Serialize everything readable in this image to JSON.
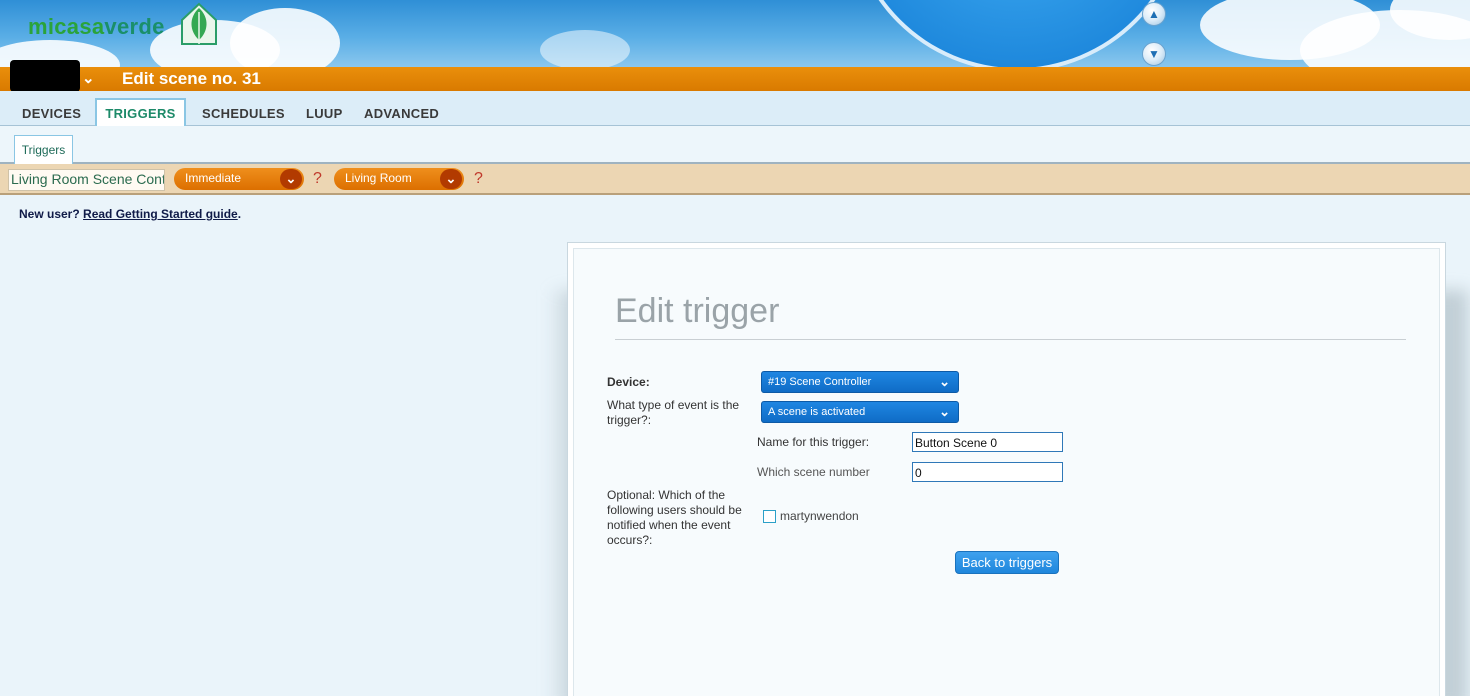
{
  "header": {
    "logo_text_part1": "micasa",
    "logo_text_part2": "verde",
    "scene_title": "Edit scene no. 31",
    "user_menu_icon": "chevron-down-icon",
    "scroll_up_icon": "eject-up-icon",
    "scroll_down_icon": "eject-down-icon"
  },
  "tabs": [
    {
      "label": "DEVICES"
    },
    {
      "label": "TRIGGERS",
      "active": true
    },
    {
      "label": "SCHEDULES"
    },
    {
      "label": "LUUP"
    },
    {
      "label": "ADVANCED"
    }
  ],
  "subtabs": [
    {
      "label": "Triggers",
      "active": true
    }
  ],
  "trigger_strip": {
    "name_value": "Living Room Scene Cont",
    "timing_value": "Immediate",
    "room_value": "Living Room",
    "help_mark": "?"
  },
  "getting_started": {
    "prefix": "New user? ",
    "link": "Read Getting Started guide",
    "suffix": "."
  },
  "dialog": {
    "title": "Edit trigger",
    "device_label": "Device:",
    "device_value": "#19 Scene Controller",
    "event_label": "What type of event is the trigger?:",
    "event_value": "A scene is activated",
    "name_label": "Name for this trigger:",
    "name_value": "Button Scene 0",
    "scene_number_label": "Which scene number",
    "scene_number_value": "0",
    "notify_label": "Optional: Which of the following users should be notified when the event occurs?:",
    "notify_user": "martynwendon",
    "back_button": "Back to triggers"
  },
  "colors": {
    "orange_bar": "#d97a00",
    "active_tab_text": "#1d8a69",
    "select_blue": "#0f6cc6",
    "strip_bg": "#ecd6b3"
  }
}
